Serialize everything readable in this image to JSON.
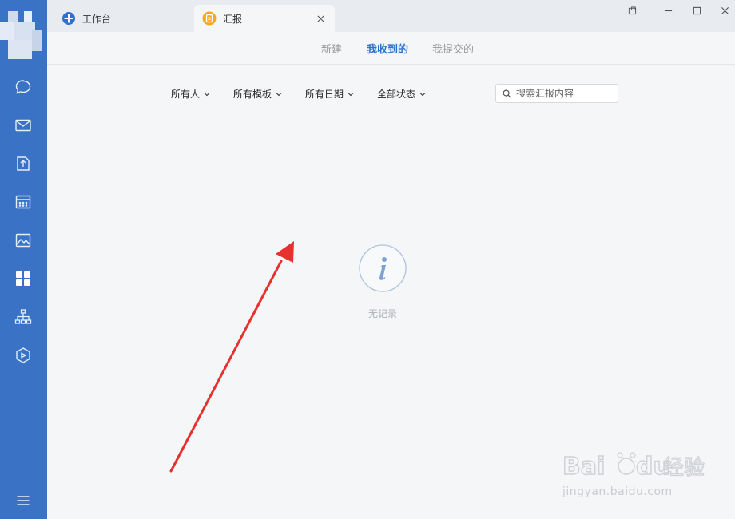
{
  "tabs": [
    {
      "label": "工作台",
      "icon": "workbench-icon"
    },
    {
      "label": "汇报",
      "icon": "report-icon"
    }
  ],
  "subtabs": [
    {
      "label": "新建"
    },
    {
      "label": "我收到的",
      "active": true
    },
    {
      "label": "我提交的"
    }
  ],
  "filters": [
    {
      "label": "所有人"
    },
    {
      "label": "所有模板"
    },
    {
      "label": "所有日期"
    },
    {
      "label": "全部状态"
    }
  ],
  "search": {
    "placeholder": "搜索汇报内容"
  },
  "empty": {
    "text": "无记录"
  },
  "colors": {
    "sidebar": "#3a73c6",
    "accent": "#2f6fcf",
    "annotation_arrow": "#e8302e"
  },
  "watermark": {
    "text": "jingyan.baidu.com",
    "logo_text": "Baidu 经验"
  }
}
